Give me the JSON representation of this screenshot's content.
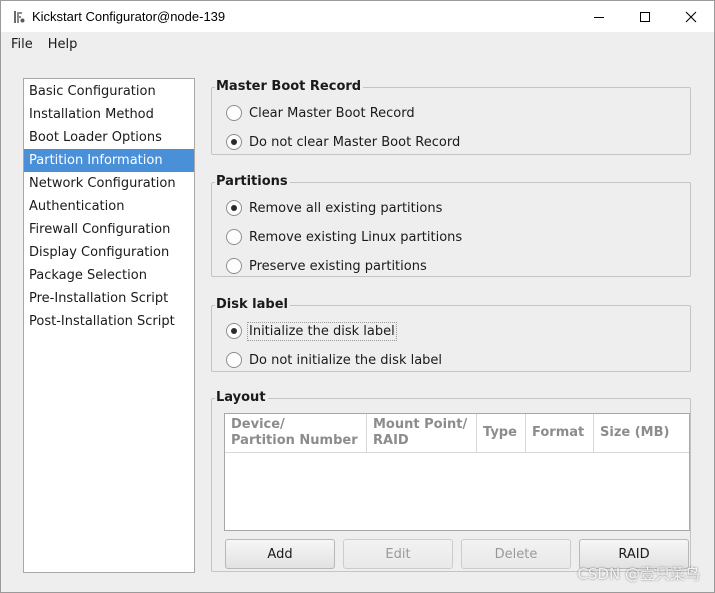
{
  "window": {
    "title": "Kickstart Configurator@node-139"
  },
  "menubar": {
    "items": [
      "File",
      "Help"
    ]
  },
  "nav": {
    "items": [
      "Basic Configuration",
      "Installation Method",
      "Boot Loader Options",
      "Partition Information",
      "Network Configuration",
      "Authentication",
      "Firewall Configuration",
      "Display Configuration",
      "Package Selection",
      "Pre-Installation Script",
      "Post-Installation Script"
    ],
    "selected": "Partition Information",
    "selected_color": "#4a90d9"
  },
  "mbr": {
    "title": "Master Boot Record",
    "options": [
      "Clear Master Boot Record",
      "Do not clear Master Boot Record"
    ],
    "selected": "Do not clear Master Boot Record"
  },
  "partitions": {
    "title": "Partitions",
    "options": [
      "Remove all existing partitions",
      "Remove existing Linux partitions",
      "Preserve existing partitions"
    ],
    "selected": "Remove all existing partitions"
  },
  "disklabel": {
    "title": "Disk label",
    "options": [
      "Initialize the disk label",
      "Do not initialize the disk label"
    ],
    "selected": "Initialize the disk label"
  },
  "layout": {
    "title": "Layout",
    "columns": [
      "Device/\nPartition Number",
      "Mount Point/\nRAID",
      "Type",
      "Format",
      "Size (MB)"
    ],
    "rows": [],
    "buttons": {
      "add": "Add",
      "edit": "Edit",
      "delete": "Delete",
      "raid": "RAID"
    }
  },
  "watermark": "CSDN @壹只菜鸟"
}
